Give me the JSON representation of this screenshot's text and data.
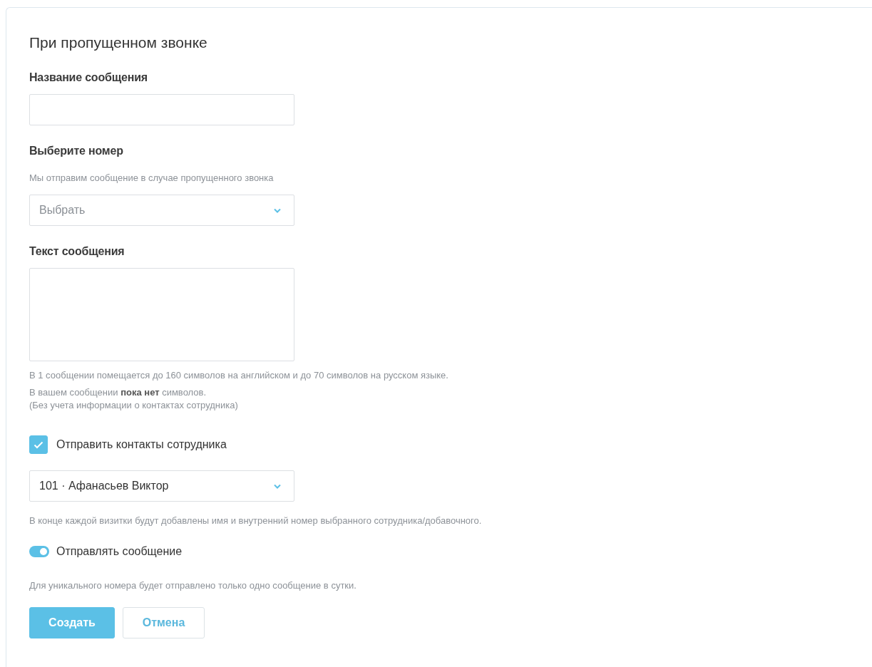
{
  "title": "При пропущенном звонке",
  "name_field": {
    "label": "Название сообщения"
  },
  "number_select": {
    "label": "Выберите номер",
    "hint": "Мы отправим сообщение в случае пропущенного звонка",
    "placeholder": "Выбрать"
  },
  "text_field": {
    "label": "Текст сообщения"
  },
  "text_notes": [
    "В 1 сообщении помещается до 160 символов на английском и до 70 символов на русском языке.",
    "В вашем сообщении **пока нет** символов.",
    "(Без учета информации о контактах сотрудника)"
  ],
  "send_contacts": {
    "label": "Отправить контакты сотрудника",
    "checked": true
  },
  "employee_select": {
    "value": "101 · Афанасьев Виктор"
  },
  "employee_note": "В конце каждой визитки будут добавлены имя и внутренний номер выбранного сотрудника/добавочного.",
  "send_toggle": {
    "label": "Отправлять сообщение",
    "on": true
  },
  "toggle_note": "Для уникального номера будет отправлено только одно сообщение в сутки.",
  "buttons": [
    {
      "label": "Создать",
      "kind": "primary"
    },
    {
      "label": "Отмена",
      "kind": "secondary"
    }
  ]
}
